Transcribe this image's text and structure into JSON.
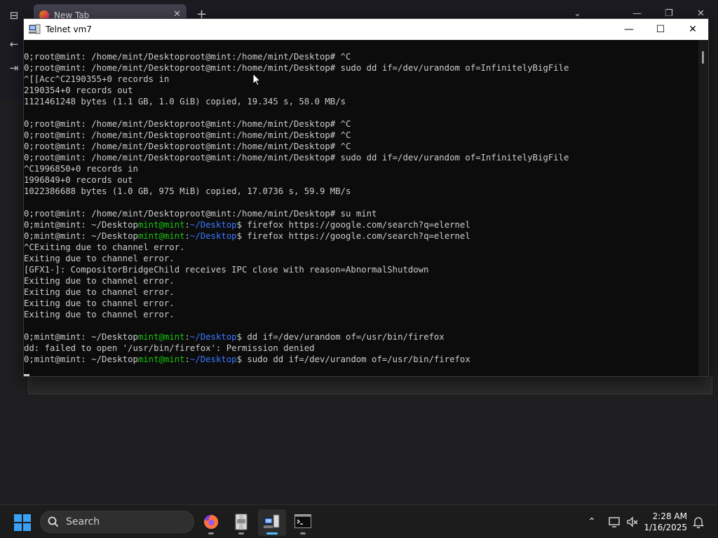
{
  "browser": {
    "tab_title": "New Tab",
    "tab_close": "✕",
    "new_tab": "+",
    "list_tabs": "⌄",
    "minimize": "—",
    "restore": "❐",
    "close": "✕"
  },
  "telnet_window": {
    "title": "Telnet vm7",
    "minimize": "—",
    "maximize": "☐",
    "close": "✕"
  },
  "terminal": {
    "lines": [
      {
        "prefix": "0;root@mint: /home/mint/Desktoproot@mint:/home/mint/Desktop# ",
        "command": "^C"
      },
      {
        "prefix": "0;root@mint: /home/mint/Desktoproot@mint:/home/mint/Desktop# ",
        "command": "sudo dd if=/dev/urandom of=InfinitelyBigFile"
      },
      {
        "text": "^[[Acc^C2190355+0 records in"
      },
      {
        "text": "2190354+0 records out"
      },
      {
        "text": "1121461248 bytes (1.1 GB, 1.0 GiB) copied, 19.345 s, 58.0 MB/s"
      },
      {
        "text": ""
      },
      {
        "prefix": "0;root@mint: /home/mint/Desktoproot@mint:/home/mint/Desktop# ",
        "command": "^C"
      },
      {
        "prefix": "0;root@mint: /home/mint/Desktoproot@mint:/home/mint/Desktop# ",
        "command": "^C"
      },
      {
        "prefix": "0;root@mint: /home/mint/Desktoproot@mint:/home/mint/Desktop# ",
        "command": "^C"
      },
      {
        "prefix": "0;root@mint: /home/mint/Desktoproot@mint:/home/mint/Desktop# ",
        "command": "sudo dd if=/dev/urandom of=InfinitelyBigFile"
      },
      {
        "text": "^C1996850+0 records in"
      },
      {
        "text": "1996849+0 records out"
      },
      {
        "text": "1022386688 bytes (1.0 GB, 975 MiB) copied, 17.0736 s, 59.9 MB/s"
      },
      {
        "text": ""
      },
      {
        "prefix": "0;root@mint: /home/mint/Desktoproot@mint:/home/mint/Desktop# ",
        "command": "su mint"
      },
      {
        "user": {
          "pre": "0;mint@mint: ~/Desktop",
          "host": "mint@mint",
          "sep": ":",
          "path": "~/Desktop",
          "end": "$ "
        },
        "command": "firefox https://google.com/search?q=elernel"
      },
      {
        "user": {
          "pre": "0;mint@mint: ~/Desktop",
          "host": "mint@mint",
          "sep": ":",
          "path": "~/Desktop",
          "end": "$ "
        },
        "command": "firefox https://google.com/search?q=elernel"
      },
      {
        "text": "^CExiting due to channel error."
      },
      {
        "text": "Exiting due to channel error."
      },
      {
        "text": "[GFX1-]: CompositorBridgeChild receives IPC close with reason=AbnormalShutdown"
      },
      {
        "text": "Exiting due to channel error."
      },
      {
        "text": "Exiting due to channel error."
      },
      {
        "text": "Exiting due to channel error."
      },
      {
        "text": "Exiting due to channel error."
      },
      {
        "text": ""
      },
      {
        "user": {
          "pre": "0;mint@mint: ~/Desktop",
          "host": "mint@mint",
          "sep": ":",
          "path": "~/Desktop",
          "end": "$ "
        },
        "command": "dd if=/dev/urandom of=/usr/bin/firefox"
      },
      {
        "text": "dd: failed to open '/usr/bin/firefox': Permission denied"
      },
      {
        "user": {
          "pre": "0;mint@mint: ~/Desktop",
          "host": "mint@mint",
          "sep": ":",
          "path": "~/Desktop",
          "end": "$ "
        },
        "command": "sudo dd if=/dev/urandom of=/usr/bin/firefox"
      }
    ]
  },
  "taskbar": {
    "search_label": "Search",
    "apps": [
      "firefox-icon",
      "archive-icon",
      "telnet-icon",
      "terminal-icon"
    ],
    "tray": {
      "chevron": "⌃",
      "clock_time": "2:28 AM",
      "clock_date": "1/16/2025"
    }
  },
  "colors": {
    "prompt_green": "#16c60c",
    "prompt_blue": "#3b78ff",
    "terminal_text": "#cccccc",
    "terminal_bg": "#0c0c0c",
    "accent": "#4cc2ff"
  }
}
